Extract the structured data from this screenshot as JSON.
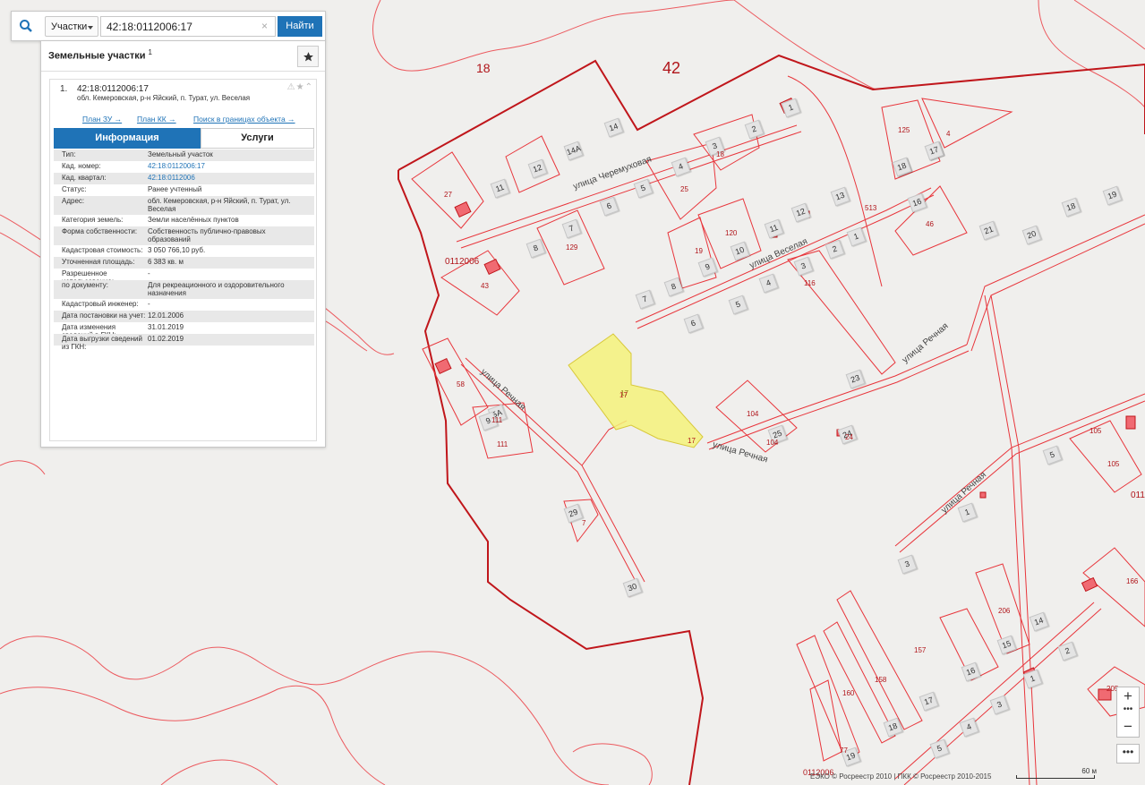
{
  "search": {
    "type_label": "Участки",
    "query": "42:18:0112006:17",
    "find_label": "Найти"
  },
  "panel": {
    "title": "Земельные участки",
    "count_sup": "1",
    "result": {
      "number": "1.",
      "cad_number": "42:18:0112006:17",
      "address": "обл. Кемеровская, р-н Яйский, п. Турат, ул. Веселая",
      "links": [
        "План ЗУ →",
        "План КК →",
        "Поиск в границах объекта →"
      ],
      "tabs": [
        "Информация",
        "Услуги"
      ],
      "attributes": [
        {
          "k": "Тип:",
          "v": "Земельный участок"
        },
        {
          "k": "Кад. номер:",
          "v": "42:18:0112006:17"
        },
        {
          "k": "Кад. квартал:",
          "v": "42:18:0112006"
        },
        {
          "k": "Статус:",
          "v": "Ранее учтенный"
        },
        {
          "k": "Адрес:",
          "v": "обл. Кемеровская, р-н Яйский, п. Турат, ул. Веселая"
        },
        {
          "k": "Категория земель:",
          "v": "Земли населённых пунктов"
        },
        {
          "k": "Форма собственности:",
          "v": "Собственность публично-правовых образований"
        },
        {
          "k": "Кадастровая стоимость:",
          "v": "3 050 766,10 руб."
        },
        {
          "k": "Уточненная площадь:",
          "v": "6 383 кв. м"
        },
        {
          "k": "Разрешенное использование:",
          "v": "-"
        },
        {
          "k": "по документу:",
          "v": "Для рекреационного и оздоровительного назначения"
        },
        {
          "k": "Кадастровый инженер:",
          "v": "-"
        },
        {
          "k": "Дата постановки на учет:",
          "v": "12.01.2006"
        },
        {
          "k": "Дата изменения сведений в ГКН:",
          "v": "31.01.2019"
        },
        {
          "k": "Дата выгрузки сведений из ГКН:",
          "v": "01.02.2019"
        }
      ]
    }
  },
  "map": {
    "labels": {
      "quarter_18": "18",
      "quarter_42": "42",
      "block": "0112006",
      "block_2": "0112006",
      "block_3": "011"
    },
    "streets": [
      "улица Черемуховая",
      "улица Веселая",
      "улица Речная",
      "улица Речная",
      "улица Речная",
      "улица Речная"
    ],
    "house_numbers": [
      "14",
      "14А",
      "12",
      "11",
      "3",
      "2",
      "4",
      "5",
      "6",
      "7",
      "8",
      "9",
      "10",
      "11",
      "12",
      "13",
      "16",
      "17",
      "18",
      "19",
      "21",
      "20",
      "18",
      "1",
      "2",
      "3",
      "4",
      "5",
      "6",
      "7",
      "8",
      "23",
      "25",
      "24",
      "5",
      "1",
      "3",
      "14",
      "15",
      "16",
      "17",
      "18",
      "19",
      "2",
      "1",
      "3",
      "4",
      "5",
      "29",
      "30",
      "5А",
      "9",
      "1",
      "18",
      "17"
    ],
    "parcel_numbers": [
      "27",
      "43",
      "129",
      "25",
      "19",
      "120",
      "18",
      "116",
      "104",
      "104",
      "58",
      "111",
      "7",
      "125",
      "4",
      "46",
      "105",
      "105",
      "166",
      "206",
      "157",
      "158",
      "160",
      "77",
      "205",
      "17",
      "17",
      "513",
      "24",
      "111"
    ],
    "selected_parcel": "17"
  },
  "controls": {
    "zoom_in": "+",
    "zoom_dots": "•••",
    "zoom_out": "−",
    "more": "•••",
    "copyright": "ЕЭКО © Росреестр 2010 | ПКК © Росреестр 2010-2015",
    "scale_label": "60 м"
  },
  "colors": {
    "accent": "#1f73b7",
    "boundary": "#e8353b",
    "quarter_boundary": "#c0161b",
    "selected_fill": "#f5f27a",
    "building": "#f06a72"
  },
  "icons": [
    "search-icon",
    "star-icon",
    "warning-icon",
    "collapse-icon",
    "close-icon"
  ]
}
